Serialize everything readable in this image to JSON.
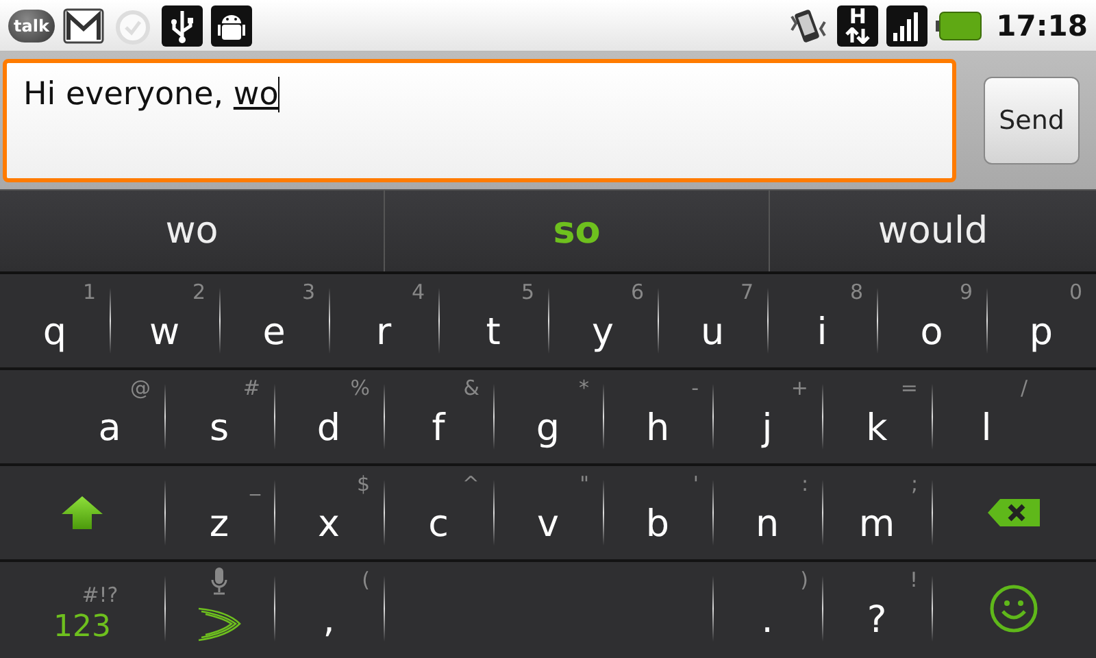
{
  "status_bar": {
    "notifications": [
      {
        "kind": "talk",
        "label": "talk"
      },
      {
        "kind": "mail"
      },
      {
        "kind": "alarm"
      },
      {
        "kind": "usb"
      },
      {
        "kind": "robot"
      }
    ],
    "indicators": [
      {
        "kind": "vibrate"
      },
      {
        "kind": "network",
        "label": "H"
      },
      {
        "kind": "signal"
      },
      {
        "kind": "battery"
      }
    ],
    "time": "17:18"
  },
  "compose": {
    "text": "Hi everyone, ",
    "composing": "wo",
    "send_label": "Send"
  },
  "suggestions": [
    {
      "text": "wo",
      "selected": false
    },
    {
      "text": "so",
      "selected": true
    },
    {
      "text": "would",
      "selected": false
    }
  ],
  "keyboard": [
    [
      {
        "kind": "letter",
        "label": "q",
        "hint": "1"
      },
      {
        "kind": "letter",
        "label": "w",
        "hint": "2"
      },
      {
        "kind": "letter",
        "label": "e",
        "hint": "3"
      },
      {
        "kind": "letter",
        "label": "r",
        "hint": "4"
      },
      {
        "kind": "letter",
        "label": "t",
        "hint": "5"
      },
      {
        "kind": "letter",
        "label": "y",
        "hint": "6"
      },
      {
        "kind": "letter",
        "label": "u",
        "hint": "7"
      },
      {
        "kind": "letter",
        "label": "i",
        "hint": "8"
      },
      {
        "kind": "letter",
        "label": "o",
        "hint": "9"
      },
      {
        "kind": "letter",
        "label": "p",
        "hint": "0"
      }
    ],
    [
      {
        "kind": "letter",
        "label": "a",
        "hint": "@"
      },
      {
        "kind": "letter",
        "label": "s",
        "hint": "#"
      },
      {
        "kind": "letter",
        "label": "d",
        "hint": "%"
      },
      {
        "kind": "letter",
        "label": "f",
        "hint": "&"
      },
      {
        "kind": "letter",
        "label": "g",
        "hint": "*"
      },
      {
        "kind": "letter",
        "label": "h",
        "hint": "-"
      },
      {
        "kind": "letter",
        "label": "j",
        "hint": "+"
      },
      {
        "kind": "letter",
        "label": "k",
        "hint": "="
      },
      {
        "kind": "letter",
        "label": "l",
        "hint": "/"
      }
    ],
    [
      {
        "kind": "shift"
      },
      {
        "kind": "letter",
        "label": "z",
        "hint": "_"
      },
      {
        "kind": "letter",
        "label": "x",
        "hint": "$"
      },
      {
        "kind": "letter",
        "label": "c",
        "hint": "^"
      },
      {
        "kind": "letter",
        "label": "v",
        "hint": "\""
      },
      {
        "kind": "letter",
        "label": "b",
        "hint": "'"
      },
      {
        "kind": "letter",
        "label": "n",
        "hint": ":"
      },
      {
        "kind": "letter",
        "label": "m",
        "hint": ";"
      },
      {
        "kind": "delete"
      }
    ],
    [
      {
        "kind": "symbols",
        "label": "123",
        "hint": "#!?"
      },
      {
        "kind": "swype"
      },
      {
        "kind": "letter",
        "label": ",",
        "hint": "("
      },
      {
        "kind": "space"
      },
      {
        "kind": "letter",
        "label": ".",
        "hint": ")"
      },
      {
        "kind": "letter",
        "label": "?",
        "hint": "!"
      },
      {
        "kind": "smiley"
      }
    ]
  ]
}
